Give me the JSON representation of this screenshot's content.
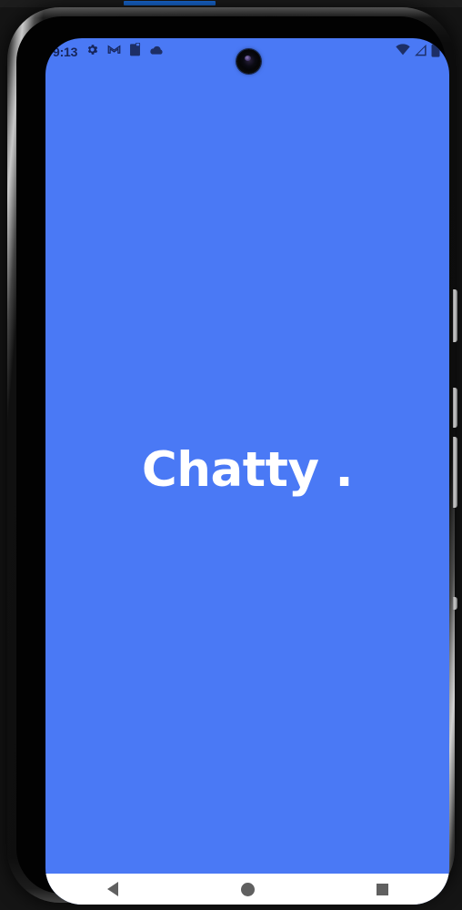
{
  "device": {
    "type": "android-phone",
    "frame_color": "#0a0a0a",
    "screen_background": "#4a79f5"
  },
  "host_window": {
    "progress_strip_color": "#1a73e8"
  },
  "status_bar": {
    "clock": "9:13",
    "left_icons": [
      {
        "name": "settings-gear-icon",
        "label": "Settings"
      },
      {
        "name": "gmail-icon",
        "label": "Gmail"
      },
      {
        "name": "clipboard-icon",
        "label": "Clipboard"
      },
      {
        "name": "cloud-icon",
        "label": "Cloud"
      }
    ],
    "right_icons": [
      {
        "name": "wifi-icon",
        "label": "Wi-Fi"
      },
      {
        "name": "cellular-signal-icon",
        "label": "Signal"
      },
      {
        "name": "battery-icon",
        "label": "Battery"
      }
    ],
    "icon_color": "#16255a"
  },
  "splash": {
    "app_title": "Chatty .",
    "title_color": "#ffffff"
  },
  "nav_bar": {
    "background": "#ffffff",
    "icon_color": "#606060",
    "buttons": [
      {
        "name": "nav-back-button",
        "label": "Back"
      },
      {
        "name": "nav-home-button",
        "label": "Home"
      },
      {
        "name": "nav-recents-button",
        "label": "Recents"
      }
    ]
  },
  "side_buttons": [
    {
      "name": "power-button",
      "label": "Power"
    },
    {
      "name": "volume-up-button",
      "label": "Volume Up"
    },
    {
      "name": "volume-down-button",
      "label": "Volume Down"
    },
    {
      "name": "extra-button",
      "label": "Extra"
    }
  ]
}
